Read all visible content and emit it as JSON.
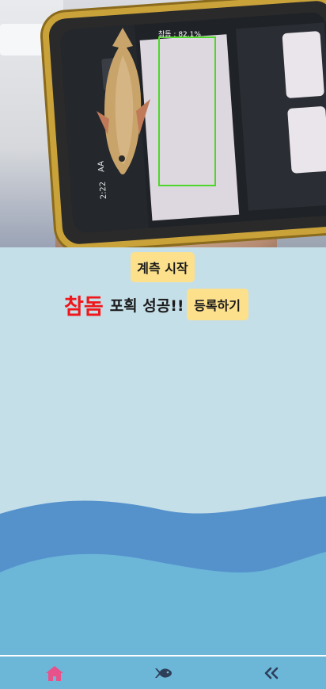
{
  "camera": {
    "detection_label": "참돔 : 82.1%",
    "phone_status": {
      "time": "2:22",
      "aa": "AA"
    }
  },
  "controls": {
    "measure_button_label": "계측 시작",
    "fish_name": "참돔",
    "catch_message": "포획 성공!!",
    "register_button_label": "등록하기"
  },
  "colors": {
    "background": "#c5dfe9",
    "button": "#fce08c",
    "fish_name": "#f0161a",
    "wave_front": "#6cb6d8",
    "wave_back": "#5592cc",
    "nav": "#6cb6d8",
    "home_active": "#e8528a",
    "nav_icon": "#2e3e58"
  },
  "nav": {
    "items": [
      {
        "icon": "home-icon",
        "active": true
      },
      {
        "icon": "fish-icon",
        "active": false
      },
      {
        "icon": "double-chevron-left-icon",
        "active": false
      }
    ]
  }
}
